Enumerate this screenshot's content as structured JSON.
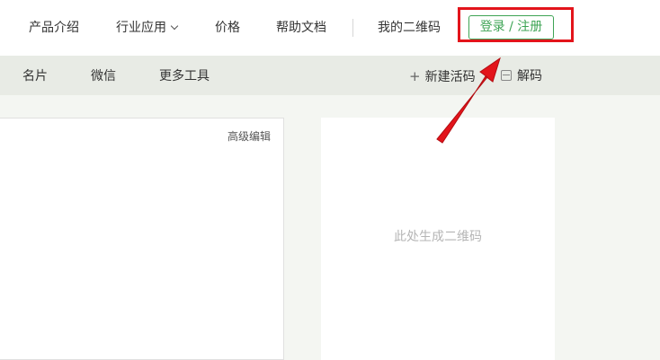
{
  "top_nav": {
    "items": [
      "产品介绍",
      "行业应用",
      "价格",
      "帮助文档",
      "我的二维码"
    ],
    "login_label": "登录 / 注册"
  },
  "sub_nav": {
    "items": [
      "名片",
      "微信",
      "更多工具"
    ],
    "new_live_code_label": "新建活码",
    "decode_label": "解码"
  },
  "editor": {
    "advanced_edit_label": "高级编辑"
  },
  "qr": {
    "placeholder": "此处生成二维码"
  },
  "colors": {
    "accent_green": "#3ea455",
    "highlight_red": "#e3141b",
    "arrow_red": "#e3141b"
  }
}
